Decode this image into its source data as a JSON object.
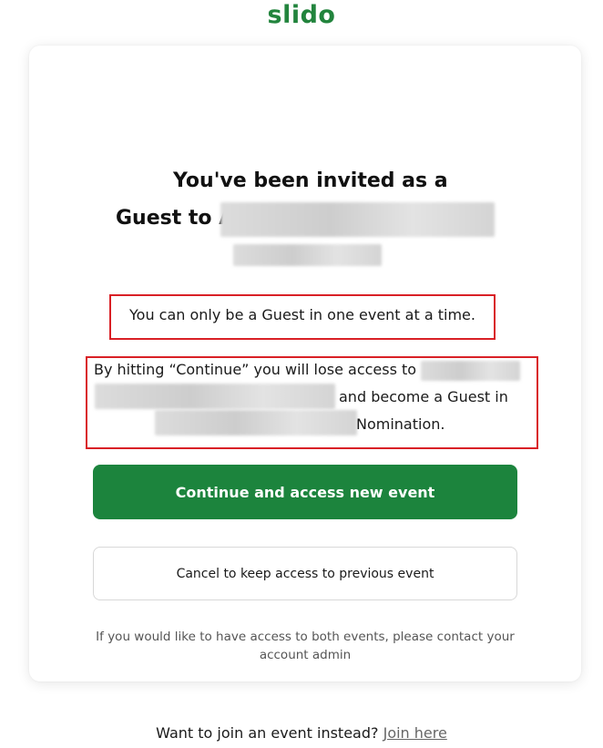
{
  "brand": {
    "logo_text": "slido",
    "logo_color": "#22843d"
  },
  "invite": {
    "title_line1": "You've been invited as a",
    "title_line2_prefix": "Guest to A"
  },
  "notices": {
    "one_event": "You can only be a Guest in one event at a time.",
    "continue_prefix": "By hitting “Continue” you will lose access to",
    "continue_middle": "and become a Guest in",
    "continue_suffix": "Nomination."
  },
  "actions": {
    "continue_label": "Continue and access new event",
    "cancel_label": "Cancel to keep access to previous event"
  },
  "helper_text": "If you would like to have access to both events, please contact your account admin",
  "footer": {
    "prompt": "Want to join an event instead?",
    "link_label": "Join here"
  },
  "colors": {
    "primary_button": "#1c843d",
    "highlight_border": "#d92026"
  }
}
